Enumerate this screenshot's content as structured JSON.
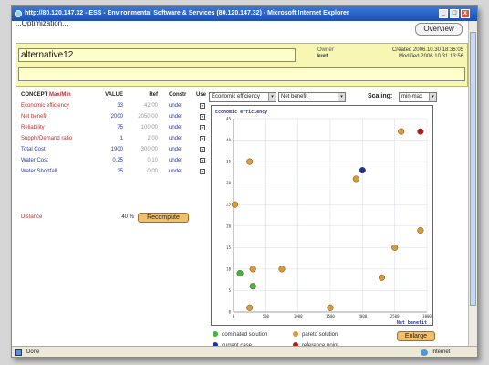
{
  "window": {
    "title": "http://80.120.147.32 - ESS - Environmental Software & Services (80.120.147.32) - Microsoft Internet Explorer",
    "minimize": "_",
    "maximize": "□",
    "close": "x"
  },
  "page": {
    "heading": "...Optimization...",
    "overview_button": "Overview"
  },
  "alternative": {
    "name": "alternative12",
    "owner_label": "Owner",
    "owner": "kurt",
    "created": "Created 2006.10.30 18:36:05",
    "modified": "Modified 2006.10.31 13:56"
  },
  "concepts": {
    "headers": {
      "concept": "CONCEPT",
      "maxmin": "Max/Min",
      "value": "VALUE",
      "ref": "Ref",
      "constr": "Constr",
      "use": "Use"
    },
    "rows": [
      {
        "name": "Economic efficiency",
        "value": "33",
        "ref": "42.00",
        "constr": "undef",
        "use": "✓"
      },
      {
        "name": "Net benefit",
        "value": "2000",
        "ref": "2050.00",
        "constr": "undef",
        "use": "✓"
      },
      {
        "name": "Reliability",
        "value": "75",
        "ref": "100.00",
        "constr": "undef",
        "use": "✓"
      },
      {
        "name": "Supply/Demand ratio",
        "value": "1",
        "ref": "2.00",
        "constr": "undef",
        "use": "✓"
      },
      {
        "name": "Total Cost",
        "value": "1900",
        "ref": "300.00",
        "constr": "undef",
        "use": "✓"
      },
      {
        "name": "Water Cost",
        "value": "0.25",
        "ref": "0.10",
        "constr": "undef",
        "use": "✓"
      },
      {
        "name": "Water Shortfall",
        "value": "25",
        "ref": "0.00",
        "constr": "undef",
        "use": "✓"
      }
    ],
    "distance_label": "Distance",
    "distance_value": "40 %",
    "recompute_button": "Recompute"
  },
  "controls": {
    "y_select": "Economic efficiency",
    "x_select": "Net benefit",
    "scaling_label": "Scaling:",
    "scaling_select": "min-max",
    "arrow": "▾"
  },
  "chart_data": {
    "type": "scatter",
    "title": "Economic efficiency",
    "xlabel": "Net benefit",
    "ylabel": "",
    "xlim": [
      0,
      3000
    ],
    "ylim": [
      0,
      45
    ],
    "xticks": [
      0,
      500,
      1000,
      1500,
      2000,
      2500,
      3000
    ],
    "yticks": [
      0,
      5,
      10,
      15,
      20,
      25,
      30,
      35,
      40,
      45
    ],
    "grid": true,
    "series": [
      {
        "name": "dominated solution",
        "color": "#3cb83c",
        "points": [
          [
            100,
            9
          ],
          [
            300,
            6
          ]
        ]
      },
      {
        "name": "pareto solution",
        "color": "#d99a3a",
        "points": [
          [
            20,
            25
          ],
          [
            250,
            35
          ],
          [
            250,
            1
          ],
          [
            300,
            10
          ],
          [
            750,
            10
          ],
          [
            1500,
            1
          ],
          [
            1900,
            31
          ],
          [
            2300,
            8
          ],
          [
            2500,
            15
          ],
          [
            2600,
            42
          ],
          [
            2900,
            19
          ]
        ]
      },
      {
        "name": "current case",
        "color": "#1f2fa0",
        "points": [
          [
            2000,
            33
          ]
        ]
      },
      {
        "name": "reference point",
        "color": "#b02020",
        "points": [
          [
            2900,
            42
          ]
        ]
      }
    ]
  },
  "legend": {
    "dominated": "dominated solution",
    "pareto": "pareto solution",
    "current": "current case",
    "reference": "reference point",
    "enlarge_button": "Enlarge"
  },
  "status": {
    "text": "Done",
    "zone": "Internet"
  }
}
